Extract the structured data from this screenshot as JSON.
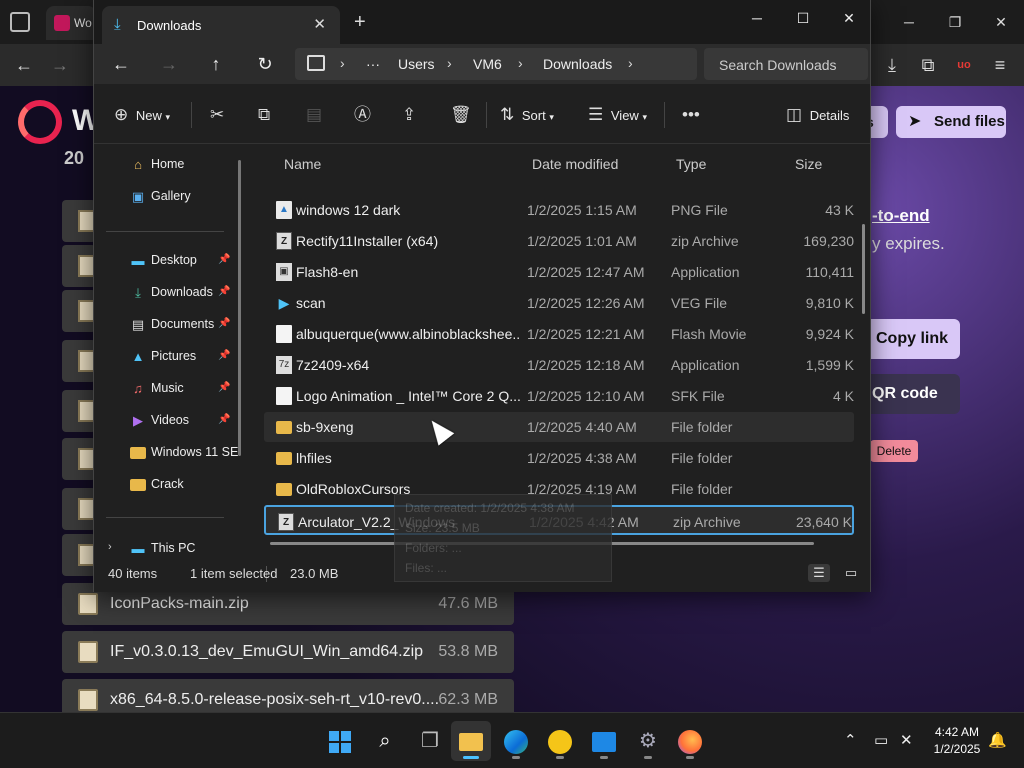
{
  "browser": {
    "tab_label": "Wo",
    "brand_initial": "W",
    "year_fragment": "20",
    "end_to_end_text": "-to-end",
    "expires_text": "y expires.",
    "partial_button_text": "s",
    "send_files_label": "Send files",
    "copy_link_label": "Copy link",
    "qr_code_label": "QR code",
    "delete_label": "Delete",
    "files": [
      {
        "name": "IconPacks-main.zip",
        "size": "47.6 MB"
      },
      {
        "name": "IF_v0.3.0.13_dev_EmuGUI_Win_amd64.zip",
        "size": "53.8 MB"
      },
      {
        "name": "x86_64-8.5.0-release-posix-seh-rt_v10-rev0....",
        "size": "62.3 MB"
      }
    ]
  },
  "explorer": {
    "tab_title": "Downloads",
    "breadcrumbs": [
      "Users",
      "VM6",
      "Downloads"
    ],
    "search_placeholder": "Search Downloads",
    "commands": {
      "new": "New",
      "sort": "Sort",
      "view": "View",
      "details": "Details"
    },
    "nav": [
      {
        "label": "Home",
        "icon": "home-icon"
      },
      {
        "label": "Gallery",
        "icon": "gallery-icon"
      },
      {
        "label": "Desktop",
        "icon": "desktop-icon",
        "pinned": true
      },
      {
        "label": "Downloads",
        "icon": "download-icon",
        "pinned": true
      },
      {
        "label": "Documents",
        "icon": "documents-icon",
        "pinned": true
      },
      {
        "label": "Pictures",
        "icon": "pictures-icon",
        "pinned": true
      },
      {
        "label": "Music",
        "icon": "music-icon",
        "pinned": true
      },
      {
        "label": "Videos",
        "icon": "videos-icon",
        "pinned": true
      },
      {
        "label": "Windows 11 SE",
        "icon": "folder-icon"
      },
      {
        "label": "Crack",
        "icon": "folder-icon"
      },
      {
        "label": "This PC",
        "icon": "pc-icon"
      }
    ],
    "columns": {
      "name": "Name",
      "date": "Date modified",
      "type": "Type",
      "size": "Size"
    },
    "rows": [
      {
        "name": "windows 12 dark",
        "date": "1/2/2025 1:15 AM",
        "type": "PNG File",
        "size": "43 K",
        "icon": "png-icon"
      },
      {
        "name": "Rectify11Installer (x64)",
        "date": "1/2/2025 1:01 AM",
        "type": "zip Archive",
        "size": "169,230",
        "icon": "zip-icon"
      },
      {
        "name": "Flash8-en",
        "date": "1/2/2025 12:47 AM",
        "type": "Application",
        "size": "110,411",
        "icon": "app-icon"
      },
      {
        "name": "scan",
        "date": "1/2/2025 12:26 AM",
        "type": "VEG File",
        "size": "9,810 K",
        "icon": "play-icon"
      },
      {
        "name": "albuquerque(www.albinoblackshee...",
        "date": "1/2/2025 12:21 AM",
        "type": "Flash Movie",
        "size": "9,924 K",
        "icon": "document-icon"
      },
      {
        "name": "7z2409-x64",
        "date": "1/2/2025 12:18 AM",
        "type": "Application",
        "size": "1,599 K",
        "icon": "app-icon"
      },
      {
        "name": "Logo Animation _ Intel™ Core 2 Q...",
        "date": "1/2/2025 12:10 AM",
        "type": "SFK File",
        "size": "4 K",
        "icon": "document-icon"
      },
      {
        "name": "sb-9xeng",
        "date": "1/2/2025 4:40 AM",
        "type": "File folder",
        "size": "",
        "icon": "folder-icon",
        "state": "hover"
      },
      {
        "name": "lhfiles",
        "date": "1/2/2025 4:38 AM",
        "type": "File folder",
        "size": "",
        "icon": "folder-icon"
      },
      {
        "name": "OldRobloxCursors",
        "date": "1/2/2025 4:19 AM",
        "type": "File folder",
        "size": "",
        "icon": "folder-icon"
      },
      {
        "name": "Arculator_V2.2_Windows",
        "date": "1/2/2025 4:42 AM",
        "type": "zip Archive",
        "size": "23,640 K",
        "icon": "zip-icon",
        "state": "selected"
      }
    ],
    "tooltip": {
      "line1": "Date created: 1/2/2025 4:38 AM",
      "line2": "Size: 23.5 MB",
      "line3": "Folders: ...",
      "line4": "Files: ..."
    },
    "status": {
      "item_count": "40 items",
      "selection": "1 item selected",
      "selection_size": "23.0 MB"
    }
  },
  "taskbar": {
    "apps": [
      "start-icon",
      "search-icon",
      "task-view-icon",
      "file-explorer-icon",
      "edge-icon",
      "app-icon",
      "store-icon",
      "settings-icon",
      "firefox-icon"
    ],
    "time": "4:42 AM",
    "date": "1/2/2025"
  }
}
